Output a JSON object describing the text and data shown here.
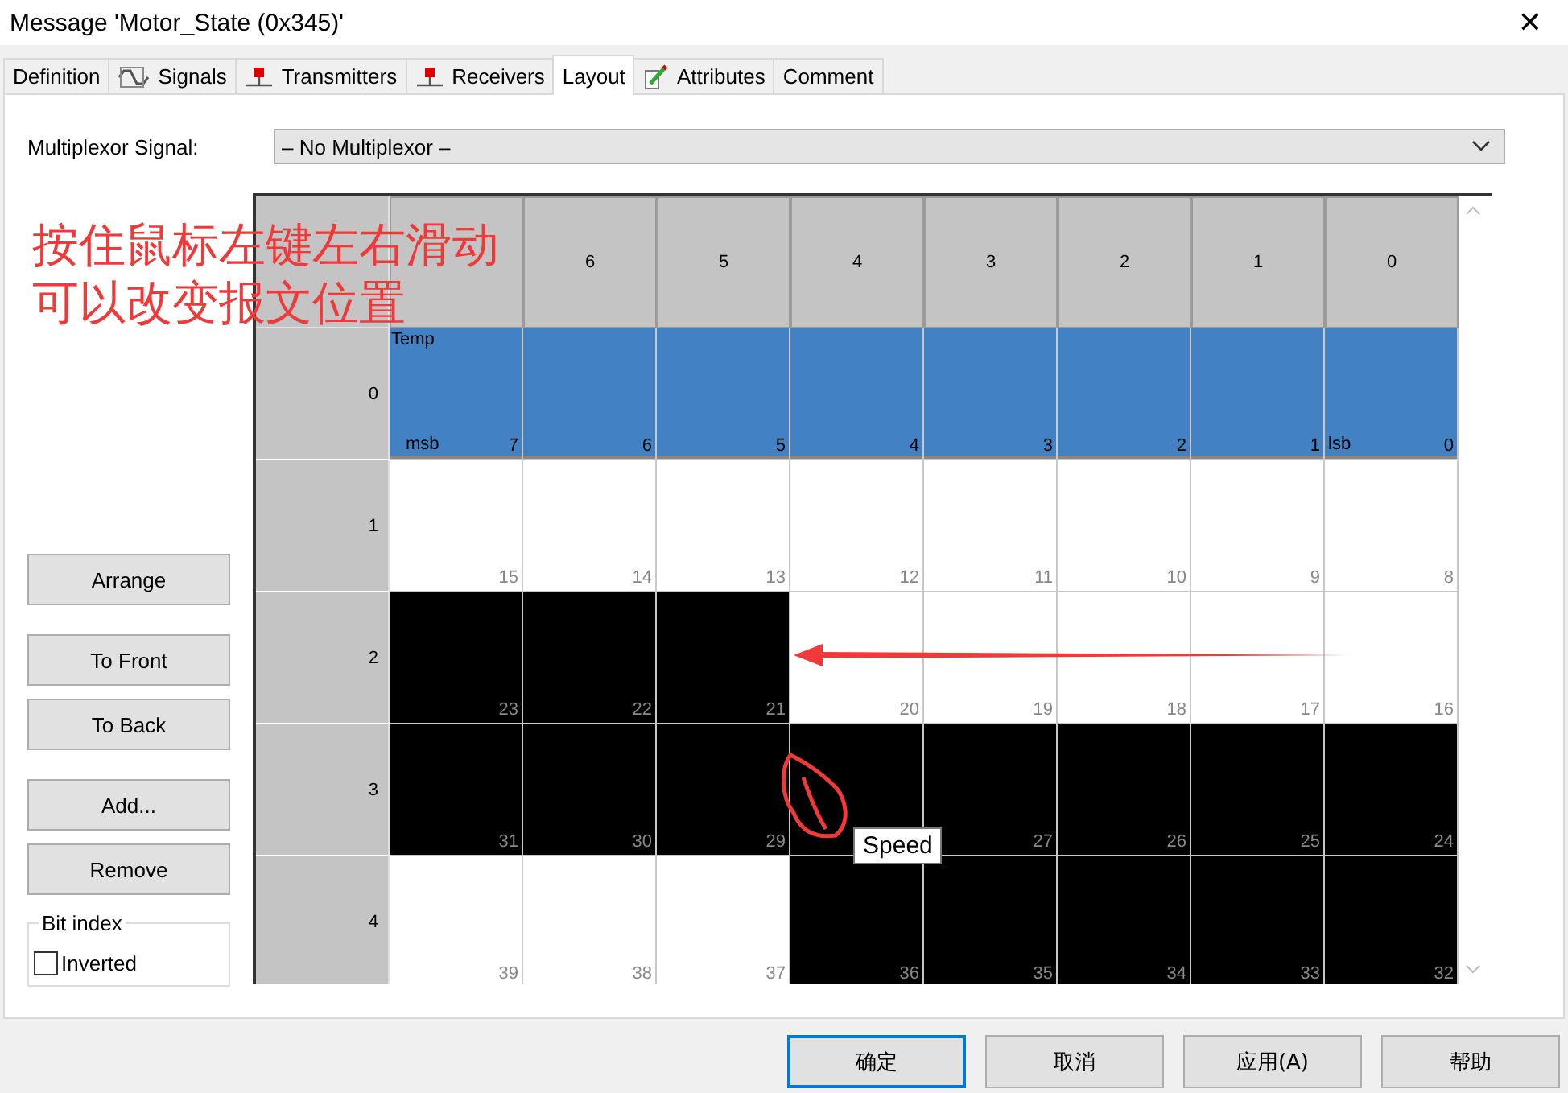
{
  "window": {
    "title": "Message 'Motor_State (0x345)'",
    "close": "✕"
  },
  "tabs": [
    {
      "label": "Definition",
      "kind": "plain",
      "selected": false
    },
    {
      "label": "Signals",
      "kind": "wave",
      "selected": false
    },
    {
      "label": "Transmitters",
      "kind": "node",
      "selected": false
    },
    {
      "label": "Receivers",
      "kind": "node",
      "selected": false
    },
    {
      "label": "Layout",
      "kind": "plain",
      "selected": true
    },
    {
      "label": "Attributes",
      "kind": "pencil",
      "selected": false
    },
    {
      "label": "Comment",
      "kind": "plain",
      "selected": false
    }
  ],
  "multiplexor": {
    "label": "Multiplexor Signal:",
    "value": "– No Multiplexor –"
  },
  "annotation": {
    "lines": [
      "按住鼠标左键左右滑动",
      "可以改变报文位置"
    ],
    "color": "#f03a3a"
  },
  "grid": {
    "columns": [
      "6",
      "5",
      "4",
      "3",
      "2",
      "1",
      "0"
    ],
    "rows": [
      {
        "label": "0",
        "signal": "Temp",
        "cells": [
          {
            "bit": "7",
            "kind": "temp",
            "marker": "msb"
          },
          {
            "bit": "6",
            "kind": "temp"
          },
          {
            "bit": "5",
            "kind": "temp"
          },
          {
            "bit": "4",
            "kind": "temp"
          },
          {
            "bit": "3",
            "kind": "temp"
          },
          {
            "bit": "2",
            "kind": "temp"
          },
          {
            "bit": "1",
            "kind": "temp"
          },
          {
            "bit": "0",
            "kind": "temp",
            "marker": "lsb"
          }
        ]
      },
      {
        "label": "1",
        "cells": [
          {
            "bit": "15",
            "kind": "empty"
          },
          {
            "bit": "14",
            "kind": "empty"
          },
          {
            "bit": "13",
            "kind": "empty"
          },
          {
            "bit": "12",
            "kind": "empty"
          },
          {
            "bit": "11",
            "kind": "empty"
          },
          {
            "bit": "10",
            "kind": "empty"
          },
          {
            "bit": "9",
            "kind": "empty"
          },
          {
            "bit": "8",
            "kind": "empty"
          }
        ]
      },
      {
        "label": "2",
        "cells": [
          {
            "bit": "23",
            "kind": "speed"
          },
          {
            "bit": "22",
            "kind": "speed"
          },
          {
            "bit": "21",
            "kind": "speed"
          },
          {
            "bit": "20",
            "kind": "empty"
          },
          {
            "bit": "19",
            "kind": "empty"
          },
          {
            "bit": "18",
            "kind": "empty"
          },
          {
            "bit": "17",
            "kind": "empty"
          },
          {
            "bit": "16",
            "kind": "empty"
          }
        ]
      },
      {
        "label": "3",
        "cells": [
          {
            "bit": "31",
            "kind": "speed"
          },
          {
            "bit": "30",
            "kind": "speed"
          },
          {
            "bit": "29",
            "kind": "speed"
          },
          {
            "kind": "speed"
          },
          {
            "bit": "27",
            "kind": "speed"
          },
          {
            "bit": "26",
            "kind": "speed"
          },
          {
            "bit": "25",
            "kind": "speed"
          },
          {
            "bit": "24",
            "kind": "speed"
          }
        ]
      },
      {
        "label": "4",
        "cells": [
          {
            "bit": "39",
            "kind": "empty"
          },
          {
            "bit": "38",
            "kind": "empty"
          },
          {
            "bit": "37",
            "kind": "empty"
          },
          {
            "bit": "36",
            "kind": "speed"
          },
          {
            "bit": "35",
            "kind": "speed"
          },
          {
            "bit": "34",
            "kind": "speed"
          },
          {
            "bit": "33",
            "kind": "speed"
          },
          {
            "bit": "32",
            "kind": "speed"
          }
        ]
      }
    ],
    "tooltip": "Speed"
  },
  "side_buttons": [
    "Arrange",
    "To Front",
    "To Back",
    "Add...",
    "Remove"
  ],
  "bit_index": {
    "title": "Bit index",
    "checkbox": {
      "label": "Inverted",
      "checked": false
    }
  },
  "dialog_buttons": [
    {
      "label": "确定",
      "default": true
    },
    {
      "label": "取消",
      "default": false
    },
    {
      "label": "应用(A)",
      "default": false
    },
    {
      "label": "帮助",
      "default": false
    }
  ]
}
